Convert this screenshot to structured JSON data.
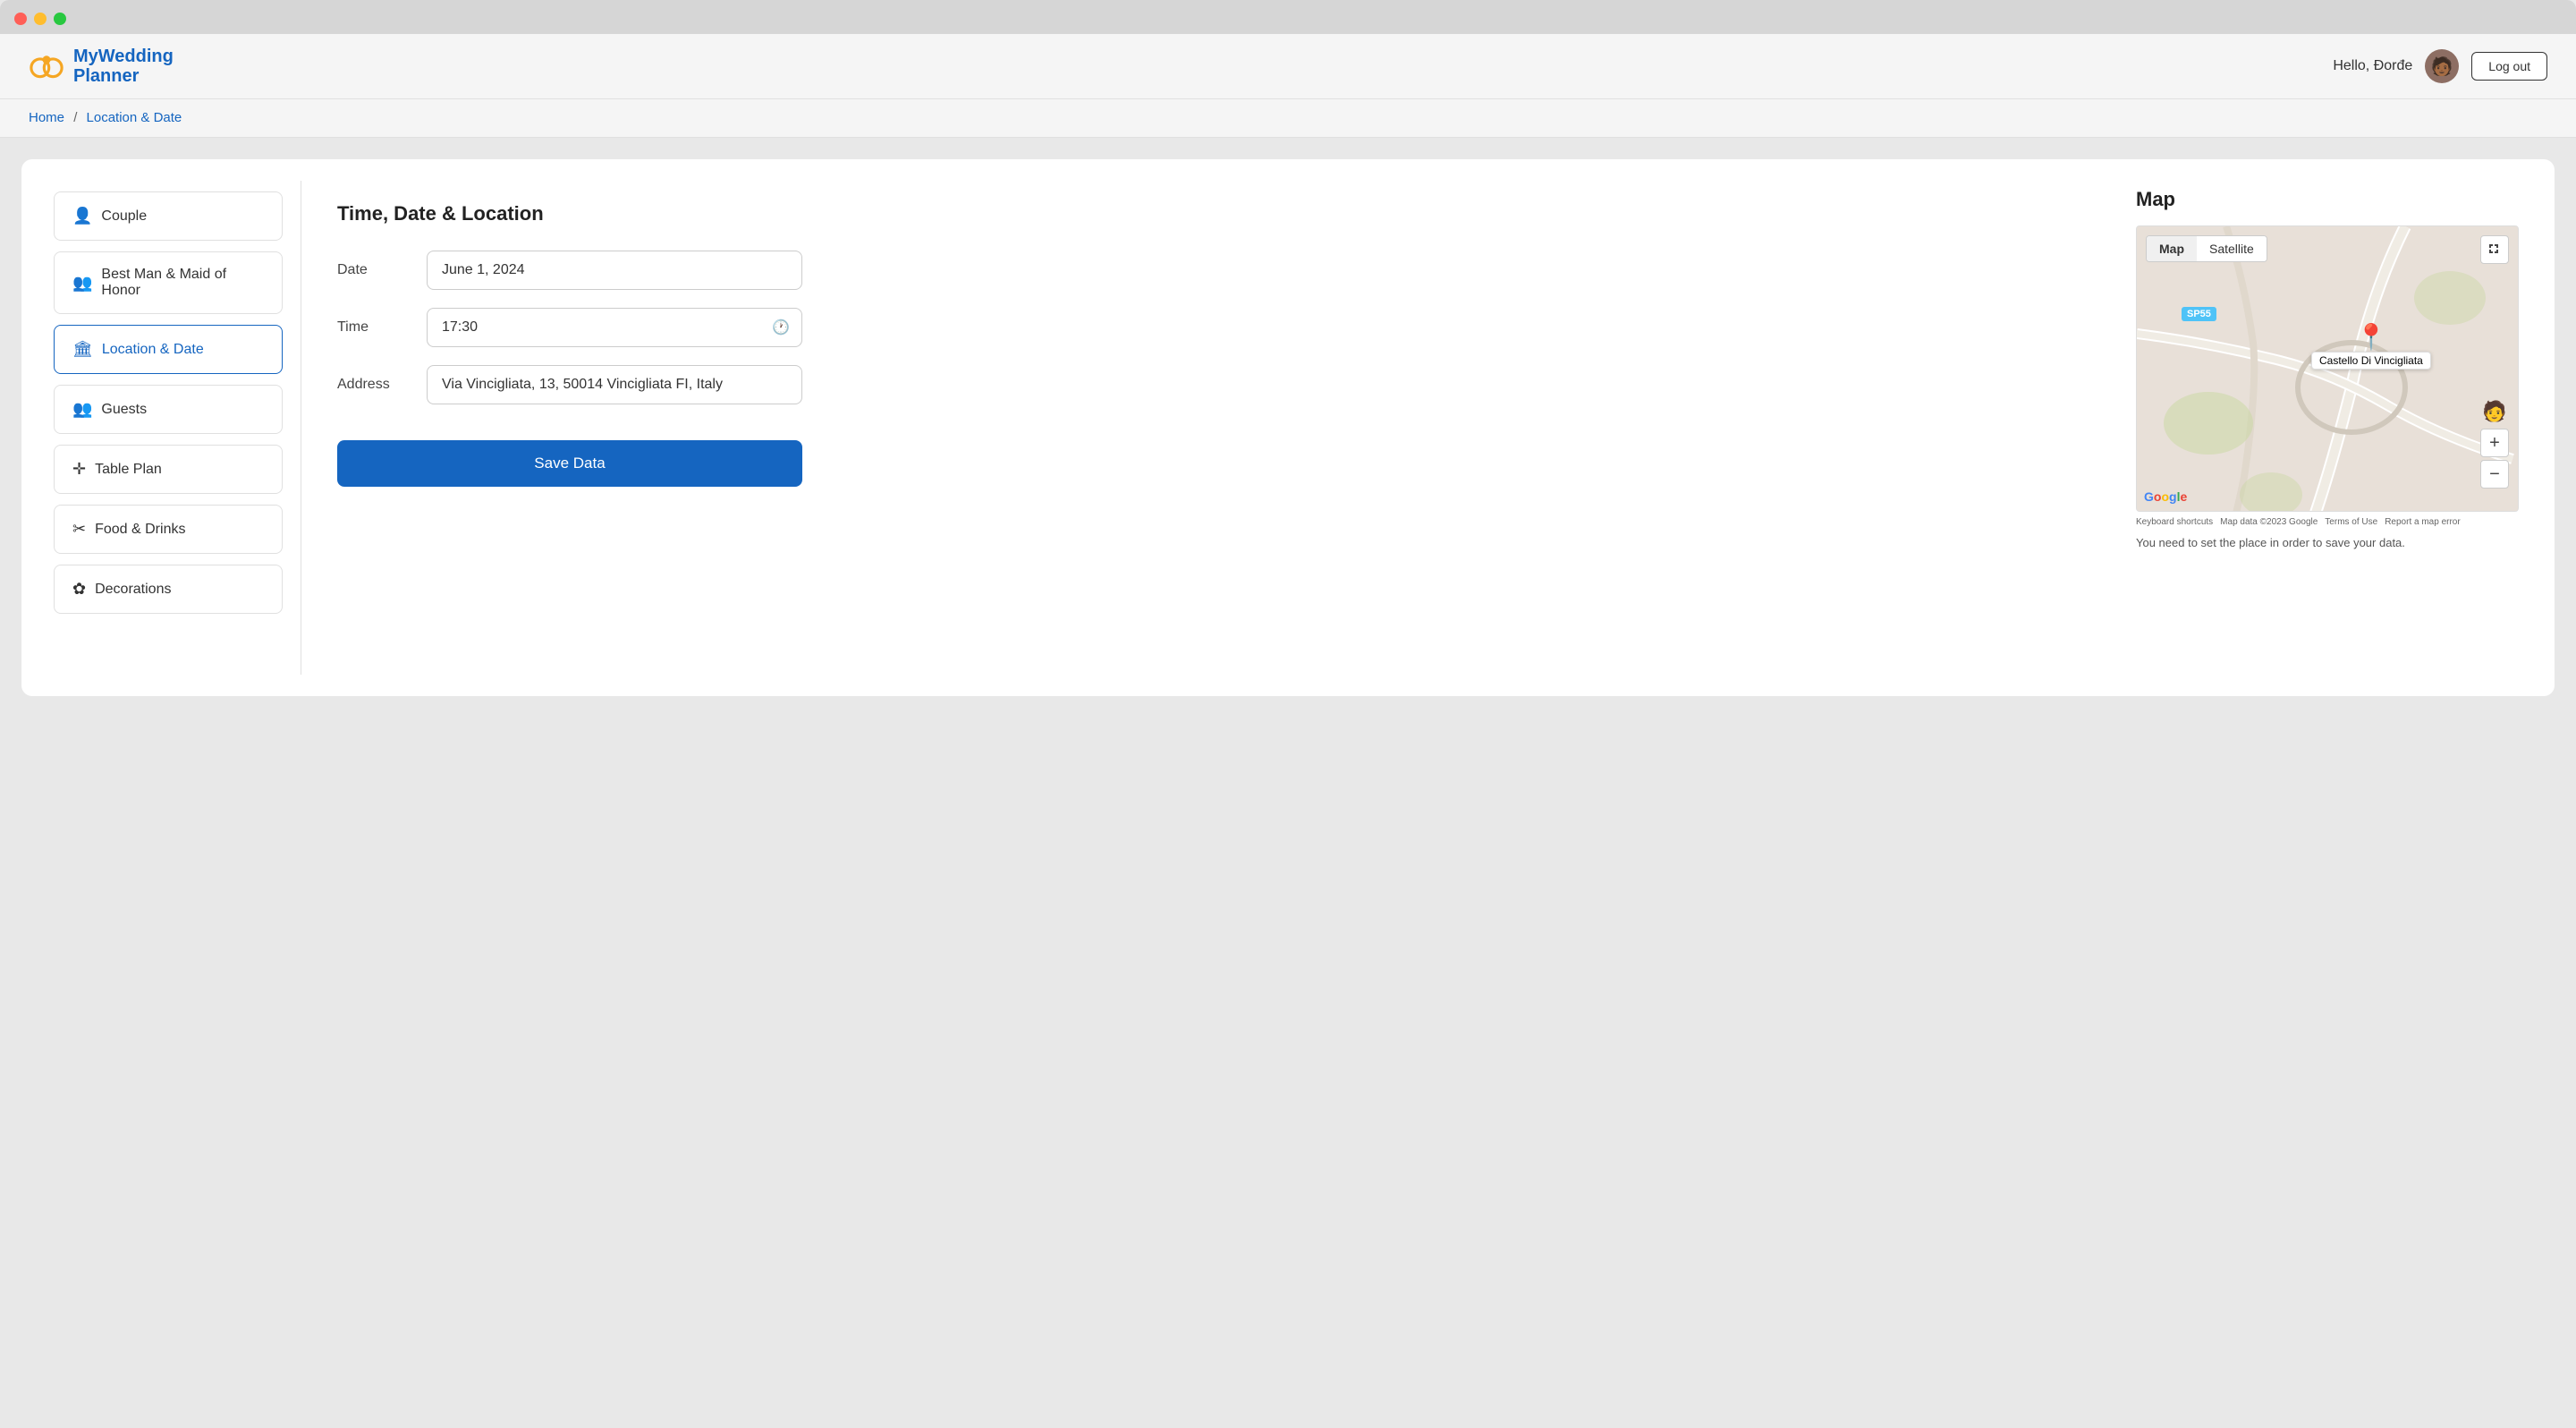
{
  "window": {
    "traffic": [
      "close",
      "minimize",
      "maximize"
    ]
  },
  "header": {
    "logo_line1": "MyWedding",
    "logo_line2": "Planner",
    "hello_text": "Hello, Đorđe",
    "logout_label": "Log out"
  },
  "breadcrumb": {
    "home": "Home",
    "separator": "/",
    "current": "Location & Date"
  },
  "sidebar": {
    "items": [
      {
        "id": "couple",
        "icon": "👤",
        "label": "Couple",
        "active": false
      },
      {
        "id": "best-man",
        "icon": "👥",
        "label": "Best Man & Maid of Honor",
        "active": false
      },
      {
        "id": "location-date",
        "icon": "🏛",
        "label": "Location & Date",
        "active": true
      },
      {
        "id": "guests",
        "icon": "👥",
        "label": "Guests",
        "active": false
      },
      {
        "id": "table-plan",
        "icon": "✛",
        "label": "Table Plan",
        "active": false
      },
      {
        "id": "food-drinks",
        "icon": "✂",
        "label": "Food & Drinks",
        "active": false
      },
      {
        "id": "decorations",
        "icon": "✿",
        "label": "Decorations",
        "active": false
      }
    ]
  },
  "form": {
    "title": "Time, Date & Location",
    "date_label": "Date",
    "date_value": "June 1, 2024",
    "time_label": "Time",
    "time_value": "17:30",
    "address_label": "Address",
    "address_value": "Via Vincigliata, 13, 50014 Vincigliata FI, Italy",
    "save_label": "Save Data"
  },
  "map": {
    "title": "Map",
    "tab_map": "Map",
    "tab_satellite": "Satellite",
    "badge_sp55": "SP55",
    "marker_label": "Castello Di Vincigliata",
    "google_label": "Google",
    "footer": {
      "keyboard": "Keyboard shortcuts",
      "map_data": "Map data ©2023 Google",
      "terms": "Terms of Use",
      "report": "Report a map error"
    },
    "note": "You need to set the place in order to save your data."
  }
}
